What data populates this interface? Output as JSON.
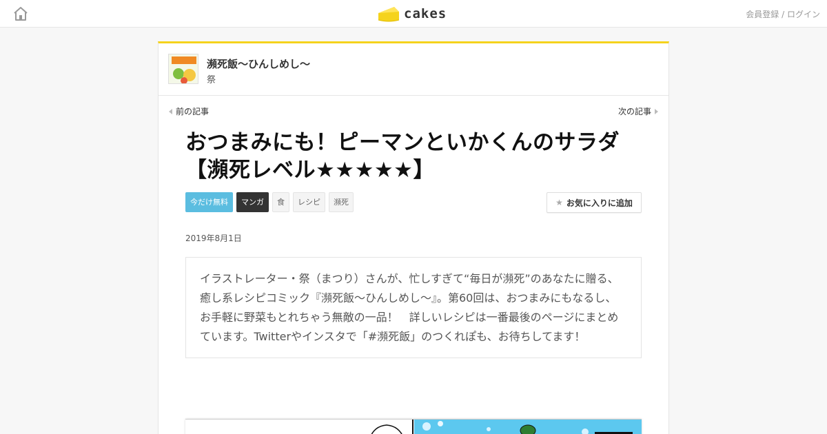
{
  "header": {
    "logo_text": "cakes",
    "register_label": "会員登録",
    "separator": " / ",
    "login_label": "ログイン",
    "home_icon": "home-icon",
    "accent_color": "#f5d31c"
  },
  "series": {
    "title": "瀕死飯～ひんしめし～",
    "author": "祭"
  },
  "nav": {
    "prev_label": "前の記事",
    "next_label": "次の記事"
  },
  "article": {
    "title": "おつまみにも！ピーマンといかくんのサラダ【瀕死レベル★★★★★】",
    "tags": [
      "今だけ無料",
      "マンガ",
      "食",
      "レシピ",
      "瀕死"
    ],
    "favorite_label": "お気に入りに追加",
    "date": "2019年8月1日",
    "lead": "イラストレーター・祭（まつり）さんが、忙しすぎて“毎日が瀕死”のあなたに贈る、癒し系レシピコミック『瀕死飯～ひんしめし～』。第60回は、おつまみにもなるし、お手軽に野菜もとれちゃう無敵の一品！　詳しいレシピは一番最後のページにまとめています。Twitterやインスタで「#瀕死飯」のつくれぽも、お待ちしてます！"
  },
  "colors": {
    "tag_free": "#5bbde0",
    "tag_manga": "#333333",
    "page_bg": "#f7f7f7"
  }
}
